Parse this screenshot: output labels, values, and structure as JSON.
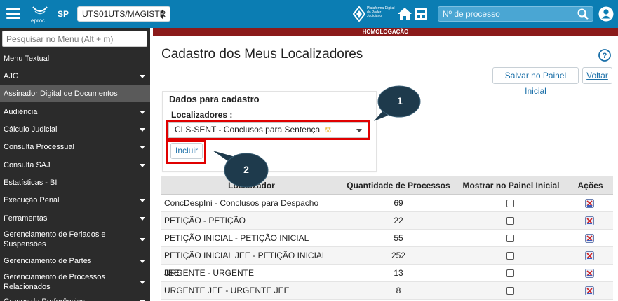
{
  "topbar": {
    "uf": "SP",
    "unit": "UTS01UTS/MAGISTR",
    "logo_text": "eproc",
    "platform_logo_text": "Plataforma Digital do Poder Judiciário",
    "process_search_placeholder": "Nº de processo"
  },
  "sidebar": {
    "search_placeholder": "Pesquisar no Menu (Alt + m)",
    "items": [
      {
        "label": "Menu Textual",
        "chevron": false
      },
      {
        "label": "AJG",
        "chevron": true
      },
      {
        "label": "Assinador Digital de Documentos",
        "chevron": false,
        "active": true
      },
      {
        "label": "Audiência",
        "chevron": true
      },
      {
        "label": "Cálculo Judicial",
        "chevron": true
      },
      {
        "label": "Consulta Processual",
        "chevron": true
      },
      {
        "label": "Consulta SAJ",
        "chevron": true
      },
      {
        "label": "Estatísticas - BI",
        "chevron": false
      },
      {
        "label": "Execução Penal",
        "chevron": true
      },
      {
        "label": "Ferramentas",
        "chevron": true
      },
      {
        "label": "Gerenciamento de Feriados e Suspensões",
        "chevron": true
      },
      {
        "label": "Gerenciamento de Partes",
        "chevron": true
      },
      {
        "label": "Gerenciamento de Processos Relacionados",
        "chevron": true
      },
      {
        "label": "Grupos de Preferências",
        "chevron": true
      }
    ]
  },
  "banner": "HOMOLOGAÇÃO",
  "page": {
    "title": "Cadastro dos Meus Localizadores",
    "save_button": "Salvar no Painel Inicial",
    "back_button": "Voltar"
  },
  "form": {
    "legend": "Dados para cadastro",
    "label": "Localizadores :",
    "selected": "CLS-SENT - Conclusos para Sentença",
    "include_button": "Incluir"
  },
  "callouts": [
    "1",
    "2"
  ],
  "table": {
    "headers": [
      "Localizador",
      "Quantidade de Processos",
      "Mostrar no Painel Inicial",
      "Ações"
    ],
    "rows": [
      {
        "localizador": "ConcDespIni - Conclusos para Despacho Inicial",
        "qtd": "69"
      },
      {
        "localizador": "PETIÇÃO - PETIÇÃO",
        "qtd": "22"
      },
      {
        "localizador": "PETIÇÃO INICIAL - PETIÇÃO INICIAL",
        "qtd": "55"
      },
      {
        "localizador": "PETIÇÃO INICIAL JEE - PETIÇÃO INICIAL JEE",
        "qtd": "252"
      },
      {
        "localizador": "URGENTE - URGENTE",
        "qtd": "13"
      },
      {
        "localizador": "URGENTE JEE - URGENTE JEE",
        "qtd": "8"
      }
    ]
  },
  "colors": {
    "topbar": "#0b7db3",
    "sidebar": "#2b2b2b",
    "banner": "#8b1a1a",
    "highlight": "#e00000",
    "callout": "#1e3a4c"
  }
}
